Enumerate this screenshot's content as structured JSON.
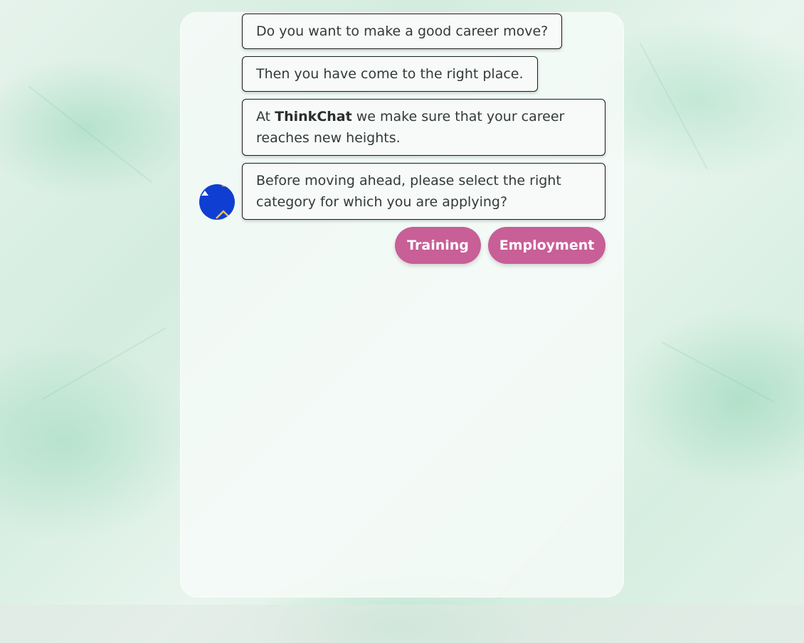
{
  "chat": {
    "messages": [
      {
        "text": "Do you want to make a good career move?"
      },
      {
        "text": "Then you have come to the right place."
      },
      {
        "prefix": "At ",
        "brand": "ThinkChat",
        "suffix": " we make sure that your career reaches new heights."
      },
      {
        "text": "Before moving ahead, please select the right category for which you are applying?"
      }
    ],
    "bot_avatar_icon": "bot-avatar-icon",
    "options": [
      {
        "label": "Training"
      },
      {
        "label": "Employment"
      }
    ]
  },
  "colors": {
    "option_button": "#c85f97",
    "avatar": "#0e3fd2",
    "avatar_accent": "#f2a23c",
    "bubble_border": "#1c1c1c",
    "background": "#dcefe5"
  }
}
